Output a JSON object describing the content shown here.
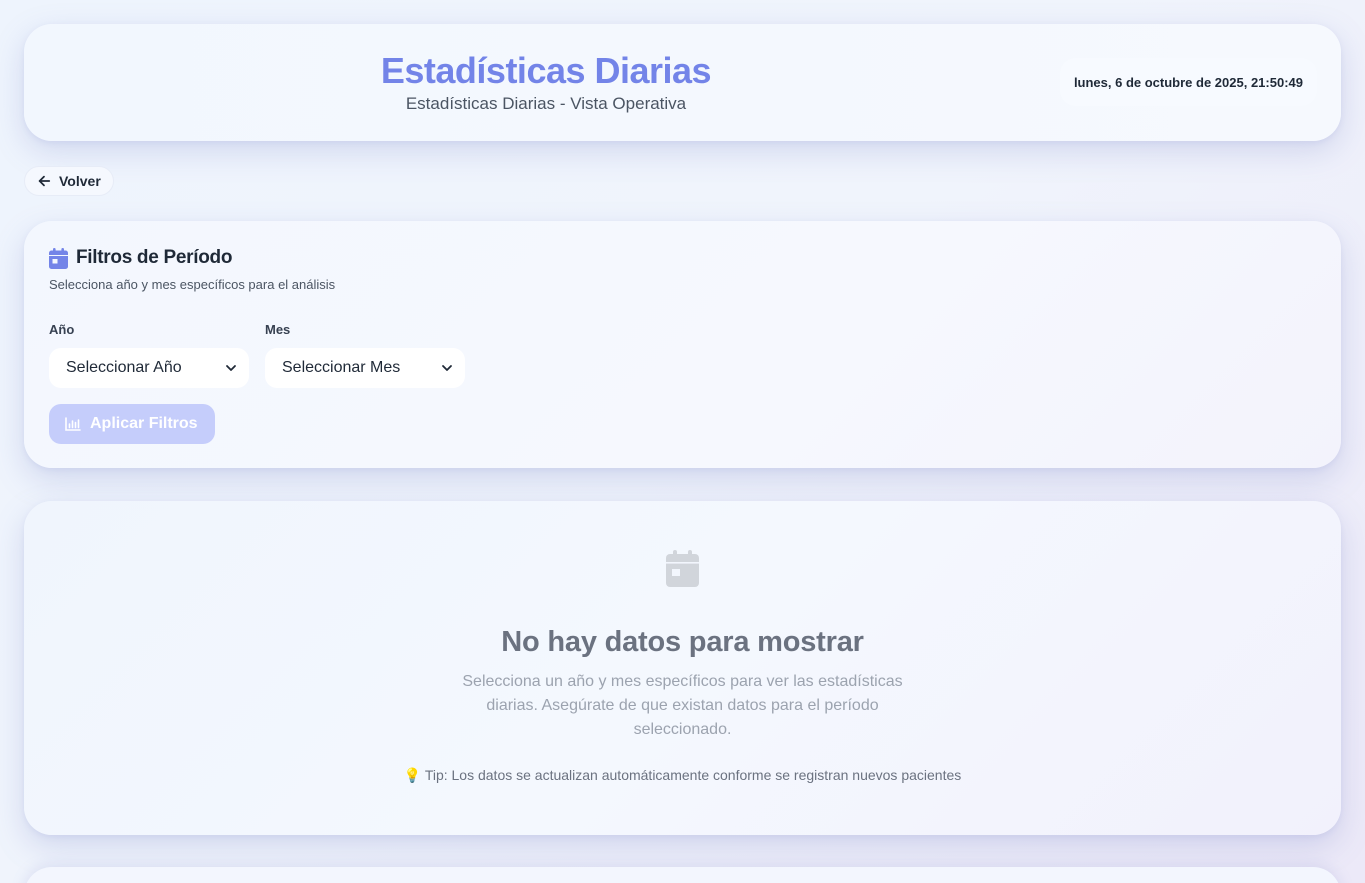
{
  "header": {
    "title": "Estadísticas Diarias",
    "subtitle": "Estadísticas Diarias - Vista Operativa",
    "datetime": "lunes, 6 de octubre de 2025, 21:50:49"
  },
  "nav": {
    "back_label": "Volver",
    "back_icon": "arrow-left-icon"
  },
  "filters": {
    "title": "Filtros de Período",
    "description": "Selecciona año y mes específicos para el análisis",
    "icon": "calendar-icon",
    "year": {
      "label": "Año",
      "value": "Seleccionar Año"
    },
    "month": {
      "label": "Mes",
      "value": "Seleccionar Mes"
    },
    "apply_label": "Aplicar Filtros",
    "apply_icon": "bar-chart-icon"
  },
  "empty_state": {
    "icon": "calendar-icon",
    "title": "No hay datos para mostrar",
    "description": "Selecciona un año y mes específicos para ver las estadísticas diarias. Asegúrate de que existan datos para el período seleccionado.",
    "tip_icon": "💡",
    "tip": "Tip: Los datos se actualizan automáticamente conforme se registran nuevos pacientes"
  },
  "colors": {
    "accent": "#7384e8",
    "apply_button_disabled": "#c5cdfb",
    "text_dark": "#1f2937",
    "text_muted": "#9ca3af"
  }
}
